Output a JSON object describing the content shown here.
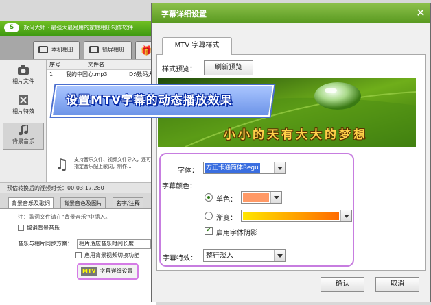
{
  "app": {
    "title": "数码大师 · 最强大最易用的家庭相册制作软件",
    "logo": "S",
    "tabs": [
      "本机相册",
      "锁屏相册"
    ],
    "nav": [
      "相片文件",
      "相片特效",
      "背景音乐"
    ],
    "file_list": {
      "headers": [
        "序号",
        "文件名"
      ],
      "row": {
        "index": "1",
        "name": "我的中国心.mp3",
        "path": "D:\\数码大"
      }
    },
    "hint": "支持音乐文件、视频文件导入，还可对指定音乐配上歌词，制作...",
    "duration": "预估转换后的视频时长：00:03:17.280",
    "bottom_tabs": [
      "背景音乐及歌词",
      "背景音色及图片",
      "名字/注释"
    ],
    "note": "注：歌词文件请在\"背景音乐\"中插入。",
    "cancel_music": "取消背景音乐",
    "sync_label": "音乐与相片同步方案：",
    "sync_value": "相片适应音乐时间长度",
    "video_switch": "启用背景视频切换功能",
    "subtitle_btn_badge": "MTV",
    "subtitle_btn": "字幕详细设置"
  },
  "dialog": {
    "title": "字幕详细设置",
    "tab": "MTV 字幕样式",
    "preview_label": "样式预览：",
    "refresh": "刷新预览",
    "preview_text": "小小的天有大大的梦想",
    "font_label": "字体：",
    "font_value": "方正卡通简体Regu",
    "color_label": "字幕颜色：",
    "solid_label": "单色：",
    "gradient_label": "渐变：",
    "shadow_label": "启用字体阴影",
    "effect_label": "字幕特效：",
    "effect_value": "整行淡入",
    "ok": "确认",
    "cancel": "取消"
  },
  "colors": {
    "solid": "#ff9966",
    "gradient_start": "#ffe600",
    "gradient_end": "#ff6a00",
    "highlight": "#c77de0",
    "green": "#5a9a21"
  },
  "caption": "设置MTV字幕的动态播放效果"
}
